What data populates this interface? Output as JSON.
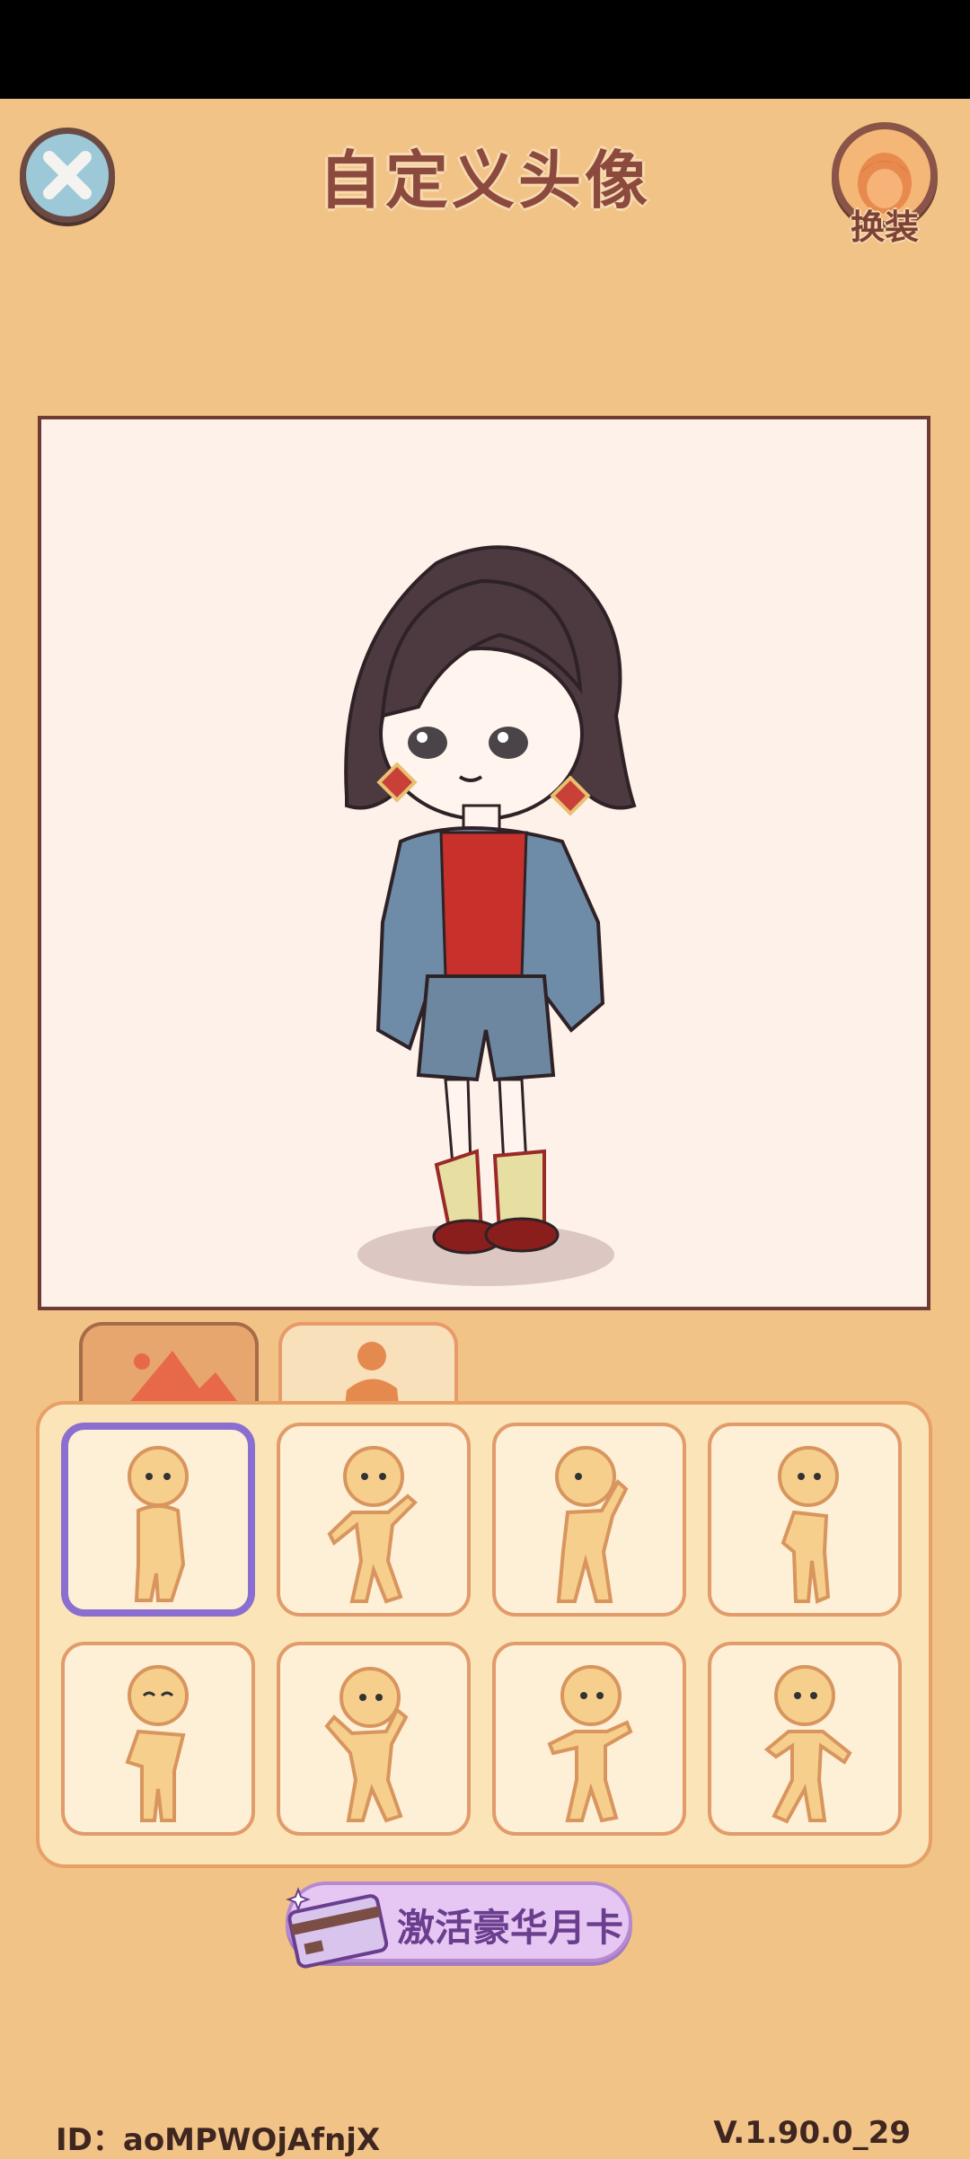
{
  "header": {
    "title": "自定义头像",
    "dress_up_label": "换装"
  },
  "tabs": [
    {
      "name": "background",
      "icon": "mountain-icon",
      "active": true
    },
    {
      "name": "pose",
      "icon": "person-icon",
      "active": false
    }
  ],
  "poses": {
    "selected_index": 0,
    "count": 8
  },
  "vip": {
    "label": "激活豪华月卡"
  },
  "footer": {
    "id_text": "ID：aoMPWOjAfnjX",
    "version": "V.1.90.0_29"
  },
  "colors": {
    "background": "#f2c386",
    "title": "#8c4a3e",
    "selected_border": "#8b6fd0"
  }
}
